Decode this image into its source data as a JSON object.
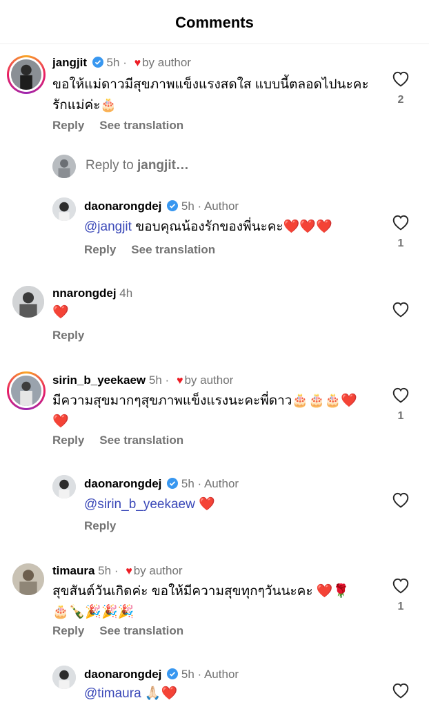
{
  "header": {
    "title": "Comments"
  },
  "reply_box": {
    "placeholder_prefix": "Reply to ",
    "placeholder_user": "jangjit…"
  },
  "labels": {
    "reply": "Reply",
    "see_translation": "See translation",
    "by_author": "by author",
    "author": "Author"
  },
  "comments": [
    {
      "username": "jangjit",
      "time": "5h",
      "text": "ขอให้แม่ดาวมีสุขภาพแข็งแรงสดใส แบบนี้ตลอดไปนะคะ",
      "text2": "รักแม่ค่ะ🎂",
      "likes": "2"
    },
    {
      "username": "daonarongdej",
      "time": "5h",
      "mention": "@jangjit",
      "text": " ขอบคุณน้องรักของพี่นะคะ❤️❤️❤️",
      "likes": "1"
    },
    {
      "username": "nnarongdej",
      "time": "4h",
      "text": "❤️"
    },
    {
      "username": "sirin_b_yeekaew",
      "time": "5h",
      "text": "มีความสุขมากๆสุขภาพแข็งแรงนะคะพี่ดาว🎂🎂🎂❤️",
      "text2": "❤️",
      "likes": "1"
    },
    {
      "username": "daonarongdej",
      "time": "5h",
      "mention": "@sirin_b_yeekaew",
      "text": " ❤️"
    },
    {
      "username": "timaura",
      "time": "5h",
      "text": "สุขสันต์วันเกิดค่ะ ขอให้มีความสุขทุกๆวันนะคะ ❤️🌹",
      "text2": "🎂🍾🎉🎉🎉",
      "likes": "1"
    },
    {
      "username": "daonarongdej",
      "time": "5h",
      "mention": "@timaura",
      "text": " 🙏🏻❤️"
    }
  ],
  "icons": {
    "like": "heart-outline-icon",
    "verified": "verified-badge-icon",
    "author_heart": "heart-filled-icon"
  },
  "colors": {
    "verified": "#3897f0",
    "heart": "#ed1c24",
    "mention": "#3a48b8"
  }
}
